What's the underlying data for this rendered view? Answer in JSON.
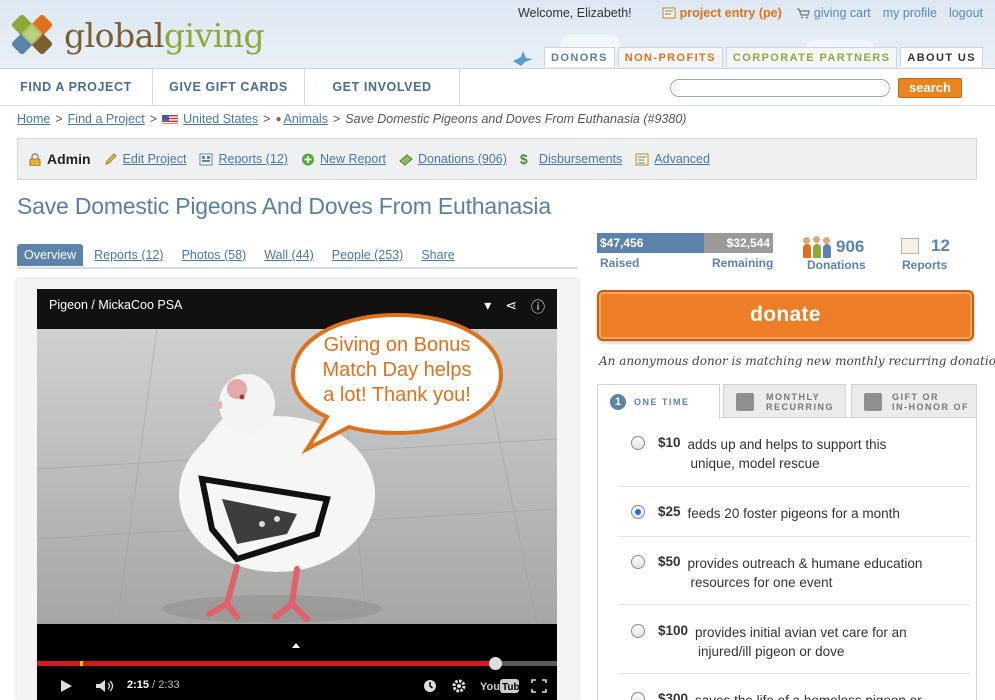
{
  "header": {
    "logo_part1": "global",
    "logo_part2": "giving",
    "welcome": "Welcome, Elizabeth!",
    "project_entry": "project entry (pe)",
    "giving_cart": "giving cart",
    "my_profile": "my profile",
    "logout": "logout",
    "audience_tabs": [
      "DONORS",
      "NON-PROFITS",
      "CORPORATE PARTNERS",
      "ABOUT US"
    ]
  },
  "nav": {
    "items": [
      "FIND A PROJECT",
      "GIVE GIFT CARDS",
      "GET INVOLVED"
    ],
    "search_placeholder": "",
    "search_button": "search"
  },
  "breadcrumb": {
    "home": "Home",
    "find": "Find a Project",
    "country": "United States",
    "category": "Animals",
    "current": "Save Domestic Pigeons and Doves From Euthanasia (#9380)"
  },
  "adminbar": {
    "admin": "Admin",
    "edit": "Edit Project",
    "reports": "Reports (12)",
    "new_report": "New Report",
    "donations": "Donations (906)",
    "disbursements": "Disbursements",
    "advanced": "Advanced"
  },
  "project_title": "Save Domestic Pigeons And Doves From Euthanasia",
  "tabs": [
    "Overview",
    "Reports (12)",
    "Photos (58)",
    "Wall (44)",
    "People (253)",
    "Share"
  ],
  "video": {
    "title": "Pigeon / MickaCoo PSA",
    "time_current": "2:15",
    "time_total": " / 2:33",
    "progress": 0.88,
    "bubble_line1": "Giving on Bonus",
    "bubble_line2": "Match Day helps",
    "bubble_line3": "a lot! Thank you!"
  },
  "stats": {
    "raised": "$47,456",
    "remaining": "$32,544",
    "raised_label": "Raised",
    "remaining_label": "Remaining",
    "donations_count": "906",
    "donations_label": "Donations",
    "reports_count": "12",
    "reports_label": "Reports"
  },
  "donate": {
    "button": "donate",
    "match_note": "An anonymous donor is matching new monthly recurring donations!",
    "tab_one_time": "ONE TIME",
    "tab_monthly_1": "MONTHLY",
    "tab_monthly_2": "RECURRING",
    "tab_gift_1": "GIFT OR",
    "tab_gift_2": "IN-HONOR OF",
    "options": [
      {
        "amount": "$10",
        "desc": "adds up and helps to support this",
        "desc2": "unique, model rescue"
      },
      {
        "amount": "$25",
        "desc": "feeds 20 foster pigeons for a month",
        "desc2": ""
      },
      {
        "amount": "$50",
        "desc": "provides outreach & humane education",
        "desc2": "resources for one event"
      },
      {
        "amount": "$100",
        "desc": "provides initial avian vet care for an",
        "desc2": "injured/ill pigeon or dove"
      },
      {
        "amount": "$300",
        "desc": "saves the life of a homeless pigeon or",
        "desc2": ""
      }
    ]
  },
  "colors": {
    "brand_blue": "#5b83ab",
    "brand_orange": "#ee7d27",
    "link": "#4a78a7"
  }
}
